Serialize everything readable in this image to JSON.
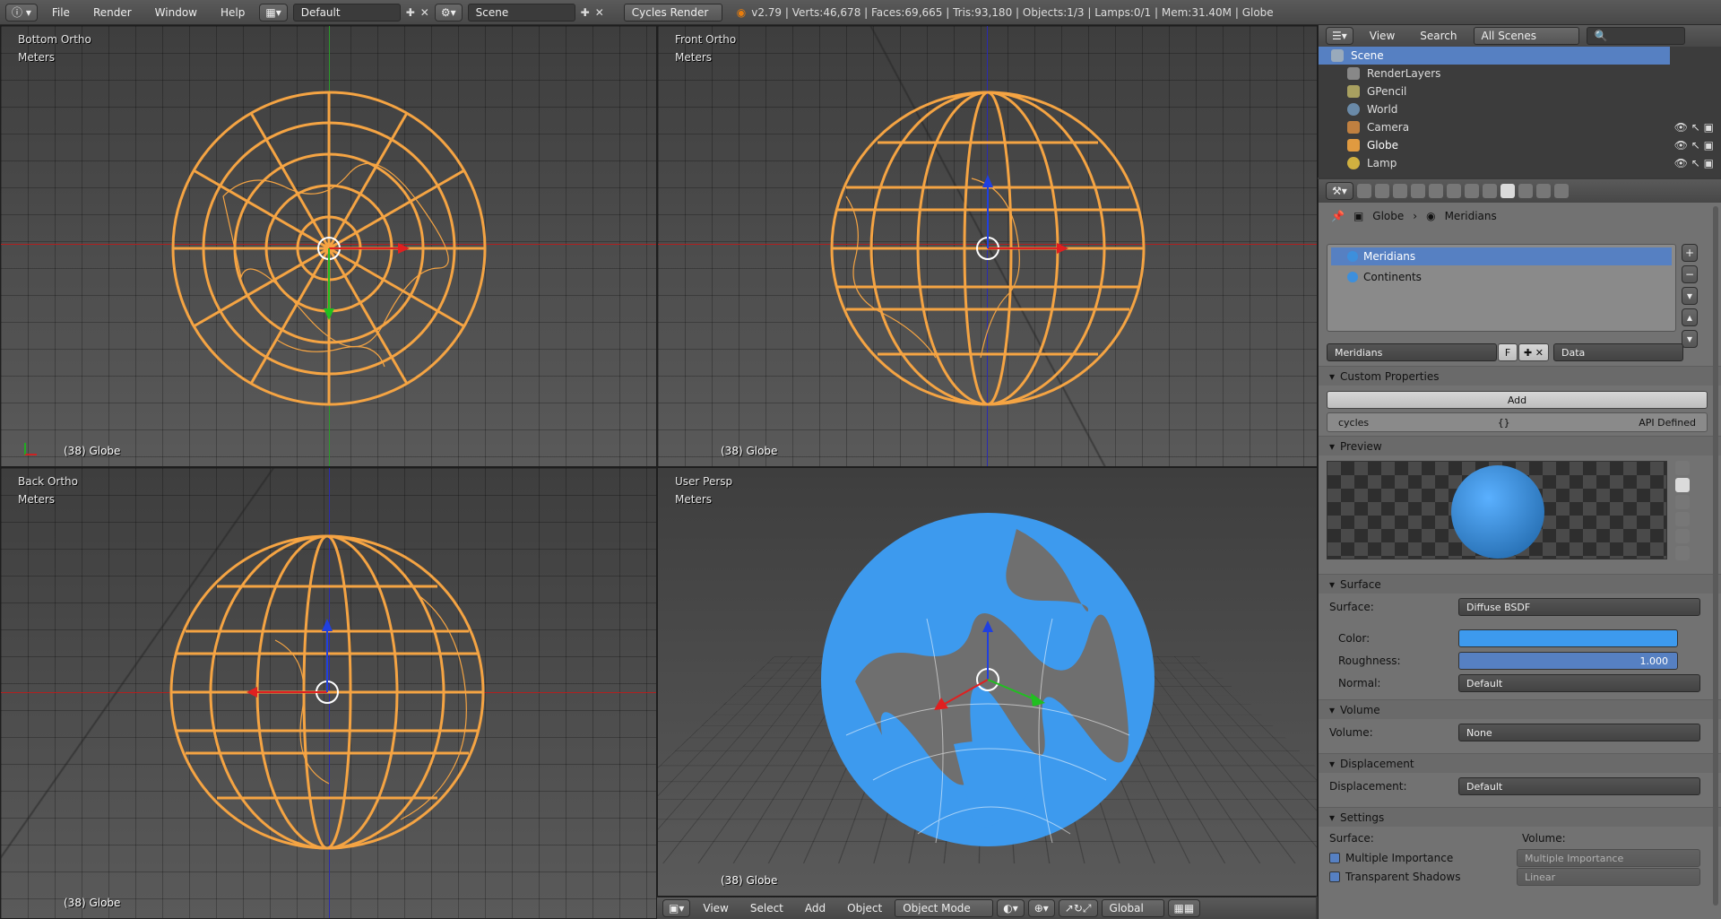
{
  "topbar": {
    "menus": [
      "File",
      "Render",
      "Window",
      "Help"
    ],
    "layout": "Default",
    "scene": "Scene",
    "engine": "Cycles Render",
    "status": "v2.79 | Verts:46,678 | Faces:69,665 | Tris:93,180 | Objects:1/3 | Lamps:0/1 | Mem:31.40M | Globe"
  },
  "viewports": [
    {
      "view": "Bottom Ortho",
      "units": "Meters",
      "object": "(38) Globe"
    },
    {
      "view": "Front Ortho",
      "units": "Meters",
      "object": "(38) Globe"
    },
    {
      "view": "Back Ortho",
      "units": "Meters",
      "object": "(38) Globe"
    },
    {
      "view": "User Persp",
      "units": "Meters",
      "object": "(38) Globe"
    }
  ],
  "vp_bar": {
    "menus": [
      "View",
      "Select",
      "Add",
      "Object"
    ],
    "mode": "Object Mode",
    "orientation": "Global"
  },
  "outliner": {
    "menus": [
      "View",
      "Search"
    ],
    "filter": "All Scenes",
    "rows": [
      {
        "label": "Scene",
        "icon": "scene-icon"
      },
      {
        "label": "RenderLayers",
        "icon": "renderlayers-icon"
      },
      {
        "label": "GPencil",
        "icon": "gpencil-icon"
      },
      {
        "label": "World",
        "icon": "world-icon"
      },
      {
        "label": "Camera",
        "icon": "camera-icon"
      },
      {
        "label": "Globe",
        "icon": "mesh-icon"
      },
      {
        "label": "Lamp",
        "icon": "lamp-icon"
      }
    ]
  },
  "properties": {
    "breadcrumb": [
      "Globe",
      "Meridians"
    ],
    "slots": [
      "Meridians",
      "Continents"
    ],
    "material_name": "Meridians",
    "fake_user": "F",
    "link": "Data",
    "custom_props": {
      "title": "Custom Properties",
      "add": "Add",
      "key": "cycles",
      "value": "{}",
      "note": "API Defined"
    },
    "preview_title": "Preview",
    "surface": {
      "title": "Surface",
      "label": "Surface:",
      "shader": "Diffuse BSDF",
      "color_label": "Color:",
      "color": "#3d9aee",
      "roughness_label": "Roughness:",
      "roughness": "1.000",
      "normal_label": "Normal:",
      "normal": "Default"
    },
    "volume": {
      "title": "Volume",
      "label": "Volume:",
      "value": "None"
    },
    "displacement": {
      "title": "Displacement",
      "label": "Displacement:",
      "value": "Default"
    },
    "settings": {
      "title": "Settings",
      "surface": "Surface:",
      "volume": "Volume:",
      "mi": "Multiple Importance",
      "mi_vol": "Multiple Importance",
      "ts": "Transparent Shadows",
      "interp": "Linear"
    }
  },
  "colors": {
    "wire": "#f5a443",
    "blue": "#3d9aee",
    "accent": "#5680c2"
  }
}
